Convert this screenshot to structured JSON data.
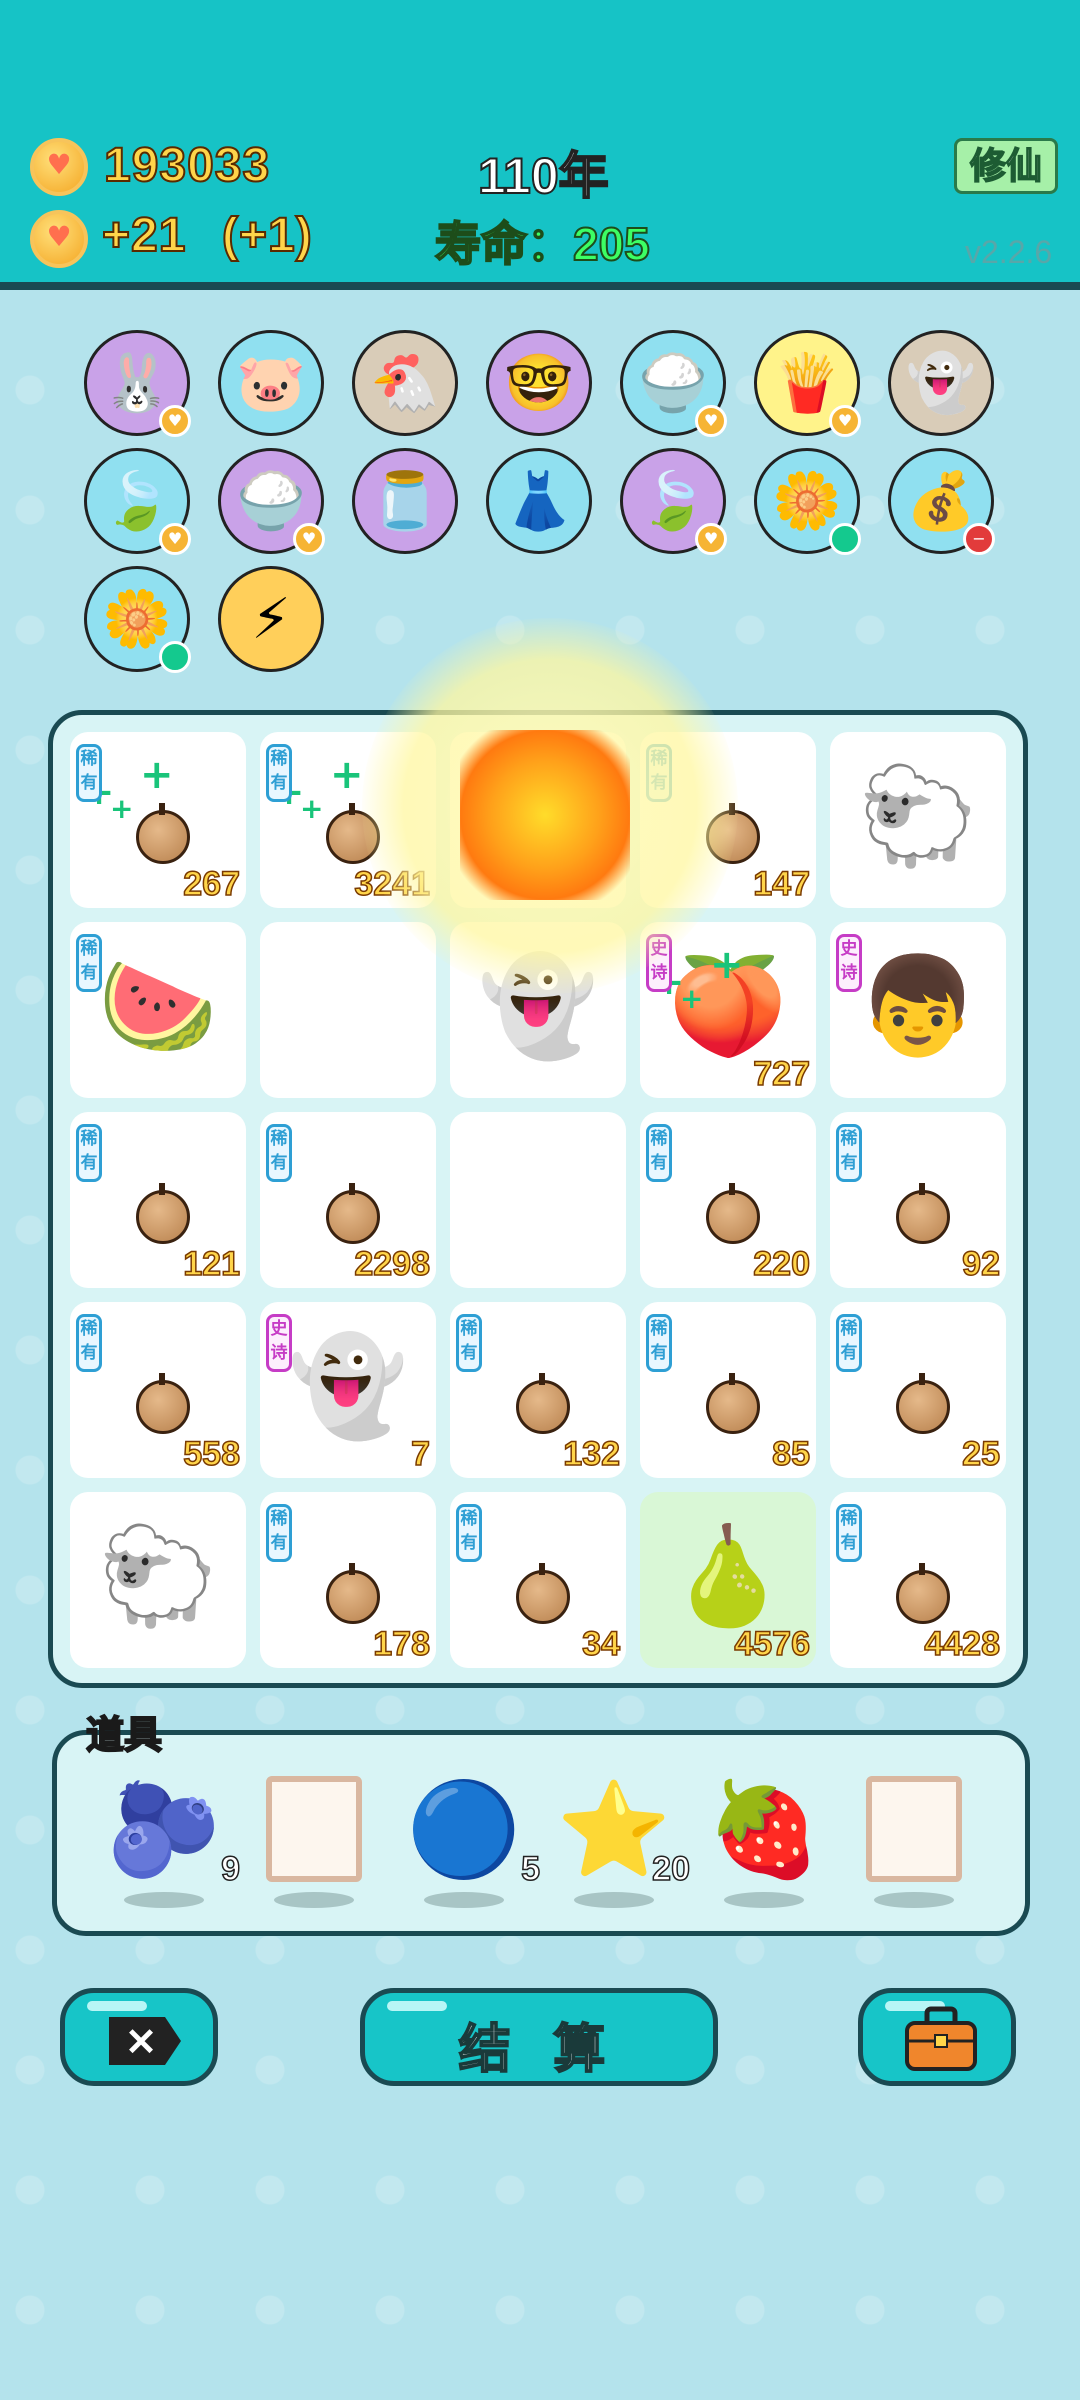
{
  "header": {
    "coins": "193033",
    "income": "+21",
    "income_bonus": "(+1)",
    "year": "110年",
    "lifespan_label": "寿命：",
    "lifespan_value": "205",
    "cultivate_button": "修仙",
    "version": "v2.2.6"
  },
  "colors": {
    "header": "#16c3c6",
    "background": "#b4e3ec",
    "accent": "#ffd54a"
  },
  "relics": [
    {
      "icon": "rabbit-icon",
      "glyph": "🐰",
      "bg": "#c9a2e8",
      "badge": "heart"
    },
    {
      "icon": "piggy-bank-icon",
      "glyph": "🐷",
      "bg": "#90e0f0",
      "badge": ""
    },
    {
      "icon": "hen-icon",
      "glyph": "🐔",
      "bg": "#d9ccb8",
      "badge": ""
    },
    {
      "icon": "math-nerd-icon",
      "glyph": "🤓",
      "bg": "#c9a2e8",
      "badge": ""
    },
    {
      "icon": "rice-bowl-icon",
      "glyph": "🍚",
      "bg": "#90e0f0",
      "badge": "heart"
    },
    {
      "icon": "french-fries-icon",
      "glyph": "🍟",
      "bg": "#fff38a",
      "badge": "heart"
    },
    {
      "icon": "ghost-icon",
      "glyph": "👻",
      "bg": "#d9ccb8",
      "badge": ""
    },
    {
      "icon": "leaf-icon",
      "glyph": "🍃",
      "bg": "#90e0f0",
      "badge": "heart"
    },
    {
      "icon": "rice-bowl-icon",
      "glyph": "🍚",
      "bg": "#c9a2e8",
      "badge": "heart"
    },
    {
      "icon": "jar-icon",
      "glyph": "🫙",
      "bg": "#c9a2e8",
      "badge": ""
    },
    {
      "icon": "skirt-icon",
      "glyph": "👗",
      "bg": "#90e0f0",
      "badge": ""
    },
    {
      "icon": "leaf-icon",
      "glyph": "🍃",
      "bg": "#c9a2e8",
      "badge": "heart"
    },
    {
      "icon": "potted-flower-icon",
      "glyph": "🌼",
      "bg": "#90e0f0",
      "badge": "green"
    },
    {
      "icon": "sack-icon",
      "glyph": "💰",
      "bg": "#90e0f0",
      "badge": "red"
    },
    {
      "icon": "potted-flower-icon",
      "glyph": "🌼",
      "bg": "#90e0f0",
      "badge": "green"
    },
    {
      "icon": "lightning-icon",
      "glyph": "⚡",
      "bg": "#ffcf5a",
      "badge": ""
    }
  ],
  "board": [
    {
      "icon": "ball-icon",
      "tag": "稀有",
      "tier": "rare",
      "value": "267",
      "plus": true
    },
    {
      "icon": "ball-icon",
      "tag": "稀有",
      "tier": "rare",
      "value": "3241",
      "plus": true
    },
    {
      "icon": "explosion-icon",
      "tag": "",
      "tier": "",
      "value": ""
    },
    {
      "icon": "ball-icon",
      "tag": "稀有",
      "tier": "rare",
      "value": "147"
    },
    {
      "icon": "sheep-icon",
      "glyph": "🐑",
      "tag": "",
      "tier": "",
      "value": ""
    },
    {
      "icon": "watermelon-icon",
      "glyph": "🍉",
      "tag": "稀有",
      "tier": "rare",
      "value": ""
    },
    {
      "icon": "empty",
      "tag": "",
      "tier": "",
      "value": ""
    },
    {
      "icon": "ghost-icon",
      "glyph": "👻",
      "tag": "",
      "tier": "",
      "value": ""
    },
    {
      "icon": "peach-icon",
      "glyph": "🍑",
      "tag": "史诗",
      "tier": "epic",
      "value": "727",
      "plus": true
    },
    {
      "icon": "boy-face-icon",
      "glyph": "👦",
      "tag": "史诗",
      "tier": "epic",
      "value": ""
    },
    {
      "icon": "ball-icon",
      "tag": "稀有",
      "tier": "rare",
      "value": "121"
    },
    {
      "icon": "ball-icon",
      "tag": "稀有",
      "tier": "rare",
      "value": "2298"
    },
    {
      "icon": "empty",
      "tag": "",
      "tier": "",
      "value": ""
    },
    {
      "icon": "ball-icon",
      "tag": "稀有",
      "tier": "rare",
      "value": "220"
    },
    {
      "icon": "ball-icon",
      "tag": "稀有",
      "tier": "rare",
      "value": "92"
    },
    {
      "icon": "ball-icon",
      "tag": "稀有",
      "tier": "rare",
      "value": "558"
    },
    {
      "icon": "ghost-icon",
      "glyph": "👻",
      "tag": "史诗",
      "tier": "epic",
      "value": "7"
    },
    {
      "icon": "ball-icon",
      "tag": "稀有",
      "tier": "rare",
      "value": "132"
    },
    {
      "icon": "ball-icon",
      "tag": "稀有",
      "tier": "rare",
      "value": "85"
    },
    {
      "icon": "ball-icon",
      "tag": "稀有",
      "tier": "rare",
      "value": "25"
    },
    {
      "icon": "sheep-icon",
      "glyph": "🐑",
      "tag": "",
      "tier": "",
      "value": ""
    },
    {
      "icon": "ball-icon",
      "tag": "稀有",
      "tier": "rare",
      "value": "178"
    },
    {
      "icon": "ball-icon",
      "tag": "稀有",
      "tier": "rare",
      "value": "34"
    },
    {
      "icon": "golden-fruit-icon",
      "glyph": "🍐",
      "tag": "",
      "tier": "",
      "value": "4576",
      "highlight": true
    },
    {
      "icon": "ball-icon",
      "tag": "稀有",
      "tier": "rare",
      "value": "4428"
    }
  ],
  "items": {
    "title": "道具",
    "list": [
      {
        "icon": "bayberry-icon",
        "glyph": "🫐",
        "qty": "9"
      },
      {
        "icon": "frame-icon",
        "glyph": "",
        "qty": ""
      },
      {
        "icon": "blueberry-icon",
        "glyph": "🔵",
        "qty": "5"
      },
      {
        "icon": "star-icon",
        "glyph": "⭐",
        "qty": "20"
      },
      {
        "icon": "strawberry-icon",
        "glyph": "🍓",
        "qty": ""
      },
      {
        "icon": "frame-icon",
        "glyph": "",
        "qty": ""
      }
    ]
  },
  "buttons": {
    "close_icon": "close-icon",
    "settle": "结 算",
    "bag_icon": "briefcase-icon"
  }
}
